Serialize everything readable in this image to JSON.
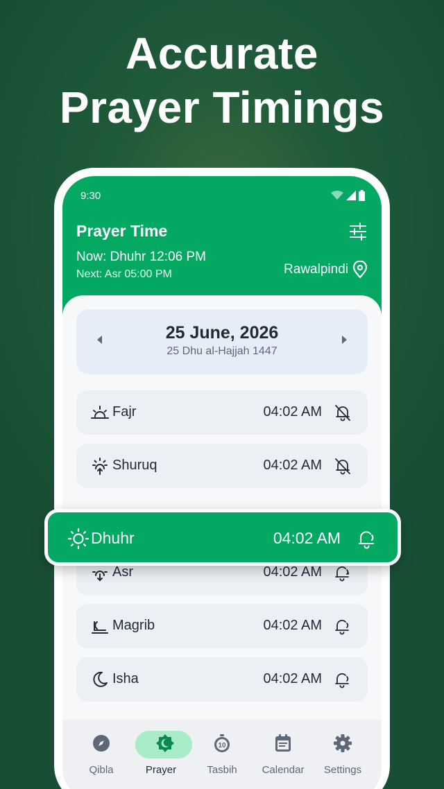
{
  "headline": {
    "line1": "Accurate",
    "line2": "Prayer Timings"
  },
  "status_bar": {
    "time": "9:30",
    "icons": [
      "wifi-icon",
      "signal-icon",
      "battery-icon"
    ]
  },
  "header": {
    "title": "Prayer Time",
    "now": "Now: Dhuhr 12:06 PM",
    "next": "Next: Asr 05:00 PM",
    "location": "Rawalpindi"
  },
  "date": {
    "gregorian": "25 June, 2026",
    "hijri": "25 Dhu al-Hajjah 1447"
  },
  "prayers": [
    {
      "name": "Fajr",
      "time": "04:02 AM",
      "icon": "sunrise-icon",
      "bell": "bell-off-icon"
    },
    {
      "name": "Shuruq",
      "time": "04:02 AM",
      "icon": "sun-up-icon",
      "bell": "bell-off-icon"
    },
    {
      "name": "Dhuhr",
      "time": "04:02 AM",
      "icon": "sun-icon",
      "bell": "bell-ring-icon",
      "active": true
    },
    {
      "name": "Asr",
      "time": "04:02 AM",
      "icon": "sun-down-icon",
      "bell": "bell-ring-icon"
    },
    {
      "name": "Magrib",
      "time": "04:02 AM",
      "icon": "sunset-icon",
      "bell": "bell-ring-icon"
    },
    {
      "name": "Isha",
      "time": "04:02 AM",
      "icon": "moon-icon",
      "bell": "bell-ring-icon"
    }
  ],
  "nav": [
    {
      "label": "Qibla",
      "icon": "compass-icon"
    },
    {
      "label": "Prayer",
      "icon": "mosque-icon",
      "active": true
    },
    {
      "label": "Tasbih",
      "icon": "counter-icon"
    },
    {
      "label": "Calendar",
      "icon": "calendar-icon"
    },
    {
      "label": "Settings",
      "icon": "gear-icon"
    }
  ],
  "colors": {
    "accent": "#03a862",
    "background": "#1f5a3a",
    "row": "#eceff3",
    "date_card": "#e5eef8"
  }
}
